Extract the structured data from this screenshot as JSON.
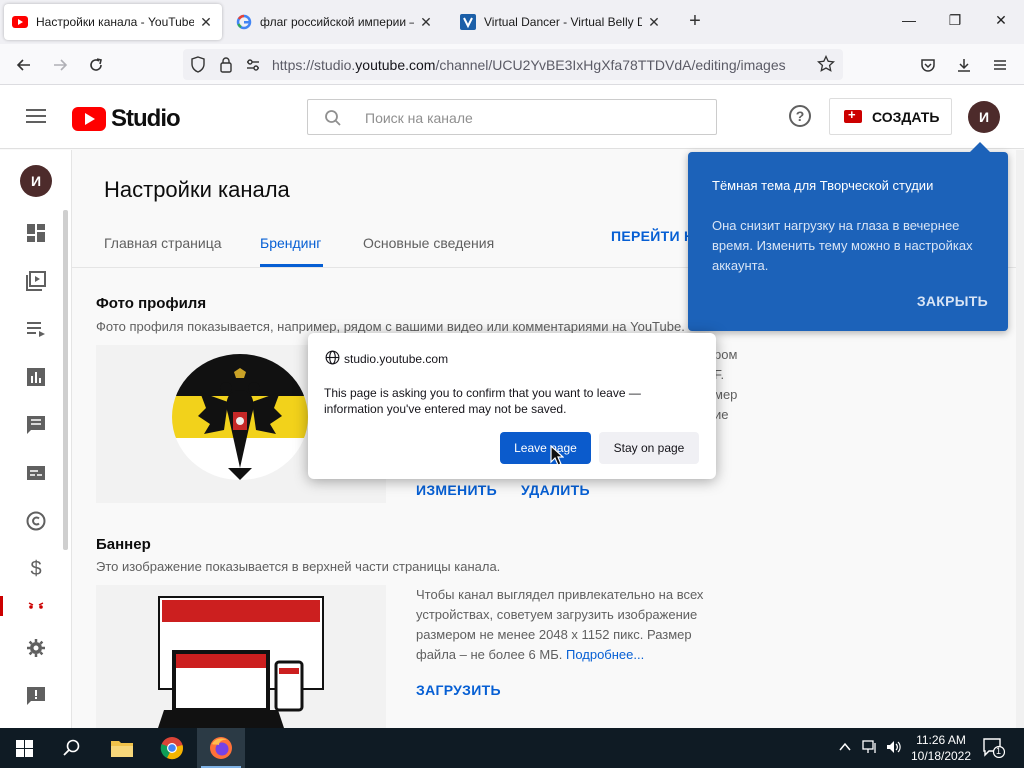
{
  "browser": {
    "tabs": [
      {
        "title": "Настройки канала - YouTube S",
        "favicon": "youtube-icon",
        "active": true
      },
      {
        "title": "флаг российской империи – G",
        "favicon": "google-icon",
        "active": false
      },
      {
        "title": "Virtual Dancer - Virtual Belly Da",
        "favicon": "site-icon",
        "active": false
      }
    ],
    "url_prefix": "https://studio.",
    "url_domain": "youtube.com",
    "url_path": "/channel/UCU2YvBE3IxHgXfa78TTDVdA/editing/images"
  },
  "header": {
    "logo_text": "Studio",
    "search_placeholder": "Поиск на канале",
    "create_label": "СОЗДАТЬ",
    "avatar_letter": "И"
  },
  "rail": {
    "avatar_letter": "И",
    "icons": [
      "dashboard-icon",
      "content-icon",
      "playlists-icon",
      "analytics-icon",
      "comments-icon",
      "subtitles-icon",
      "copyright-icon",
      "monetization-icon",
      "customization-icon",
      "settings-icon",
      "feedback-icon"
    ]
  },
  "page": {
    "title": "Настройки канала",
    "tabs": [
      "Главная страница",
      "Брендинг",
      "Основные сведения"
    ],
    "active_tab": "Брендинг",
    "goto_label": "ПЕРЕЙТИ Н"
  },
  "profile": {
    "title": "Фото профиля",
    "description": "Фото профиля показывается, например, рядом с вашими видео или комментариями на YouTube.",
    "side_lines": [
      "ром",
      "F.",
      "мер",
      "ие"
    ],
    "change_label": "ИЗМЕНИТЬ",
    "delete_label": "УДАЛИТЬ"
  },
  "banner": {
    "title": "Баннер",
    "description": "Это изображение показывается в верхней части страницы канала.",
    "info": "Чтобы канал выглядел привлекательно на всех устройствах, советуем загрузить изображение размером не менее 2048 x 1152 пикс. Размер файла – не более 6 МБ.",
    "more_link": "Подробнее...",
    "upload_label": "ЗАГРУЗИТЬ"
  },
  "tooltip": {
    "title": "Тёмная тема для Творческой студии",
    "body": "Она снизит нагрузку на глаза в вечернее время. Изменить тему можно в настройках аккаунта.",
    "close_label": "ЗАКРЫТЬ"
  },
  "dialog": {
    "host": "studio.youtube.com",
    "message": "This page is asking you to confirm that you want to leave — information you've entered may not be saved.",
    "leave_label": "Leave page",
    "stay_label": "Stay on page"
  },
  "taskbar": {
    "time": "11:26 AM",
    "date": "10/18/2022",
    "notification_count": "1",
    "pinned": [
      "file-explorer-icon",
      "chrome-icon",
      "firefox-icon"
    ]
  },
  "colors": {
    "youtube_red": "#ff0000",
    "link_blue": "#065fd4",
    "tooltip_blue": "#1c62b9",
    "dialog_button_blue": "#0b5bcc"
  }
}
